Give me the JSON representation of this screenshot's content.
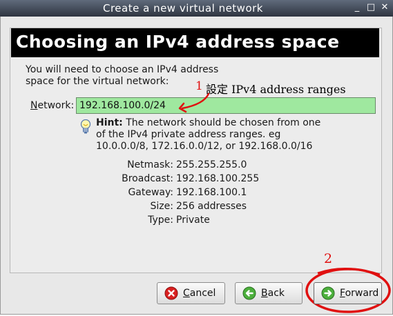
{
  "window": {
    "title": "Create a new virtual network"
  },
  "page": {
    "heading": "Choosing an IPv4 address space",
    "intro_line1": "You will need to choose an IPv4 address",
    "intro_line2": "space for the virtual network:"
  },
  "network": {
    "label_mnemonic": "N",
    "label_rest": "etwork:",
    "value": "192.168.100.0/24"
  },
  "hint": {
    "bold": "Hint:",
    "line1": " The network should be chosen from one",
    "line2": "of the IPv4 private address ranges. eg",
    "line3": "10.0.0.0/8,  172.16.0.0/12, or 192.168.0.0/16"
  },
  "details": {
    "netmask_label": "Netmask:",
    "netmask": "255.255.255.0",
    "broadcast_label": "Broadcast:",
    "broadcast": "192.168.100.255",
    "gateway_label": "Gateway:",
    "gateway": "192.168.100.1",
    "size_label": "Size:",
    "size": "256 addresses",
    "type_label": "Type:",
    "type": "Private"
  },
  "annotations": {
    "step1_number": "1",
    "step1_text": "設定 IPv4 address ranges",
    "step2_number": "2",
    "color": "#e01010"
  },
  "buttons": {
    "cancel_mnemonic": "C",
    "cancel_rest": "ancel",
    "back_mnemonic": "B",
    "back_rest": "ack",
    "forward_mnemonic": "F",
    "forward_rest": "orward"
  },
  "icons": {
    "hint": "lightbulb-icon",
    "cancel": "close-circle-icon",
    "back": "arrow-left-circle-icon",
    "forward": "arrow-right-circle-icon"
  }
}
